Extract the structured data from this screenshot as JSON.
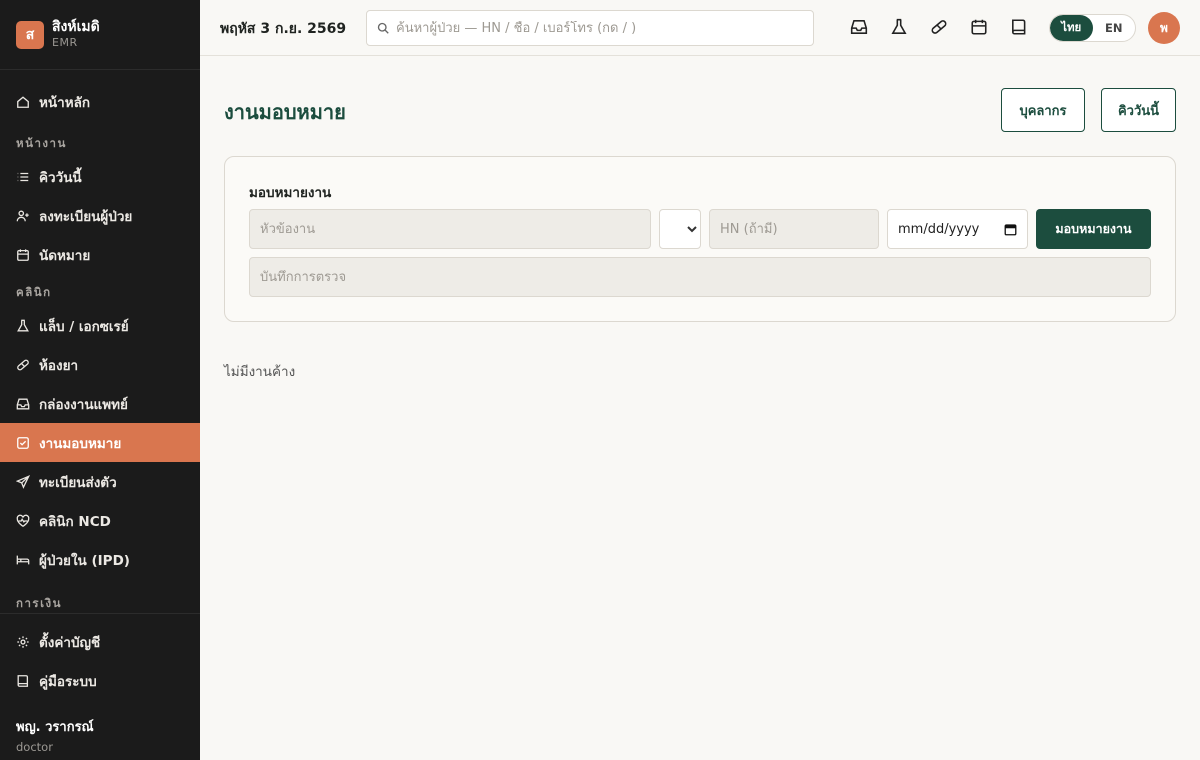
{
  "brand": {
    "logo_letter": "ส",
    "name": "สิงห์เมดิ",
    "sub": "EMR"
  },
  "sidebar": {
    "home": "หน้าหลัก",
    "section_work": "หน้างาน",
    "queue": "คิววันนี้",
    "register": "ลงทะเบียนผู้ป่วย",
    "appointments": "นัดหมาย",
    "section_clinic": "คลินิก",
    "lab": "แล็บ / เอกซเรย์",
    "pharmacy": "ห้องยา",
    "inbox": "กล่องงานแพทย์",
    "tasks": "งานมอบหมาย",
    "referral": "ทะเบียนส่งตัว",
    "ncd": "คลินิก NCD",
    "ipd": "ผู้ป่วยใน (IPD)",
    "section_finance": "การเงิน",
    "settings": "ตั้งค่าบัญชี",
    "manual": "คู่มือระบบ",
    "user_name": "พญ. วรากรณ์",
    "user_role": "doctor"
  },
  "topbar": {
    "date": "พฤหัส 3 ก.ย. 2569",
    "search_placeholder": "ค้นหาผู้ป่วย — HN / ชื่อ / เบอร์โทร (กด / )",
    "lang_th": "ไทย",
    "lang_en": "EN",
    "avatar_letter": "พ"
  },
  "icons": {
    "search": "search-icon",
    "inbox": "inbox-icon",
    "lab": "flask-icon",
    "pharmacy": "pill-icon",
    "calendar": "calendar-icon",
    "manual": "book-icon"
  },
  "main": {
    "title": "งานมอบหมาย",
    "staff_button": "บุคลากร",
    "queue_button": "คิววันนี้",
    "card_title": "มอบหมายงาน",
    "task_placeholder": "หัวข้องาน",
    "assignee_value": "",
    "hn_placeholder": "HN (ถ้ามี)",
    "date_value": "mm/dd/yyyy",
    "assign_button": "มอบหมายงาน",
    "note_placeholder": "บันทึกการตรวจ",
    "empty_text": "ไม่มีงานค้าง"
  },
  "colors": {
    "accent": "#d9764f",
    "primary": "#1c4d3e",
    "sidebar_bg": "#1b1b1b"
  }
}
